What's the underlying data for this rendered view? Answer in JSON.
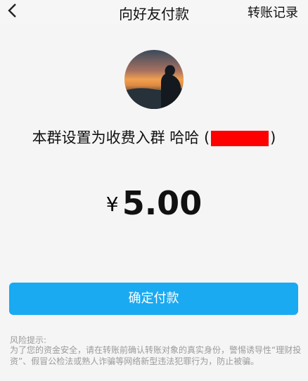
{
  "header": {
    "back_icon": "chevron-left-icon",
    "title": "向好友付款",
    "record_label": "转账记录"
  },
  "payee": {
    "description_prefix": "本群设置为收费入群 哈哈 (",
    "description_suffix": ")"
  },
  "payment": {
    "currency_symbol": "¥",
    "amount": "5.00"
  },
  "actions": {
    "confirm_label": "确定付款"
  },
  "risk_notice": {
    "title": "风险提示:",
    "body": "为了您的资金安全，请在转账前确认转账对象的真实身份，警惕诱导性“理财投资”、假冒公检法或熟人诈骗等网络新型违法犯罪行为，防止被骗。"
  },
  "colors": {
    "accent": "#1aaaf2",
    "redaction": "#ff0000"
  }
}
